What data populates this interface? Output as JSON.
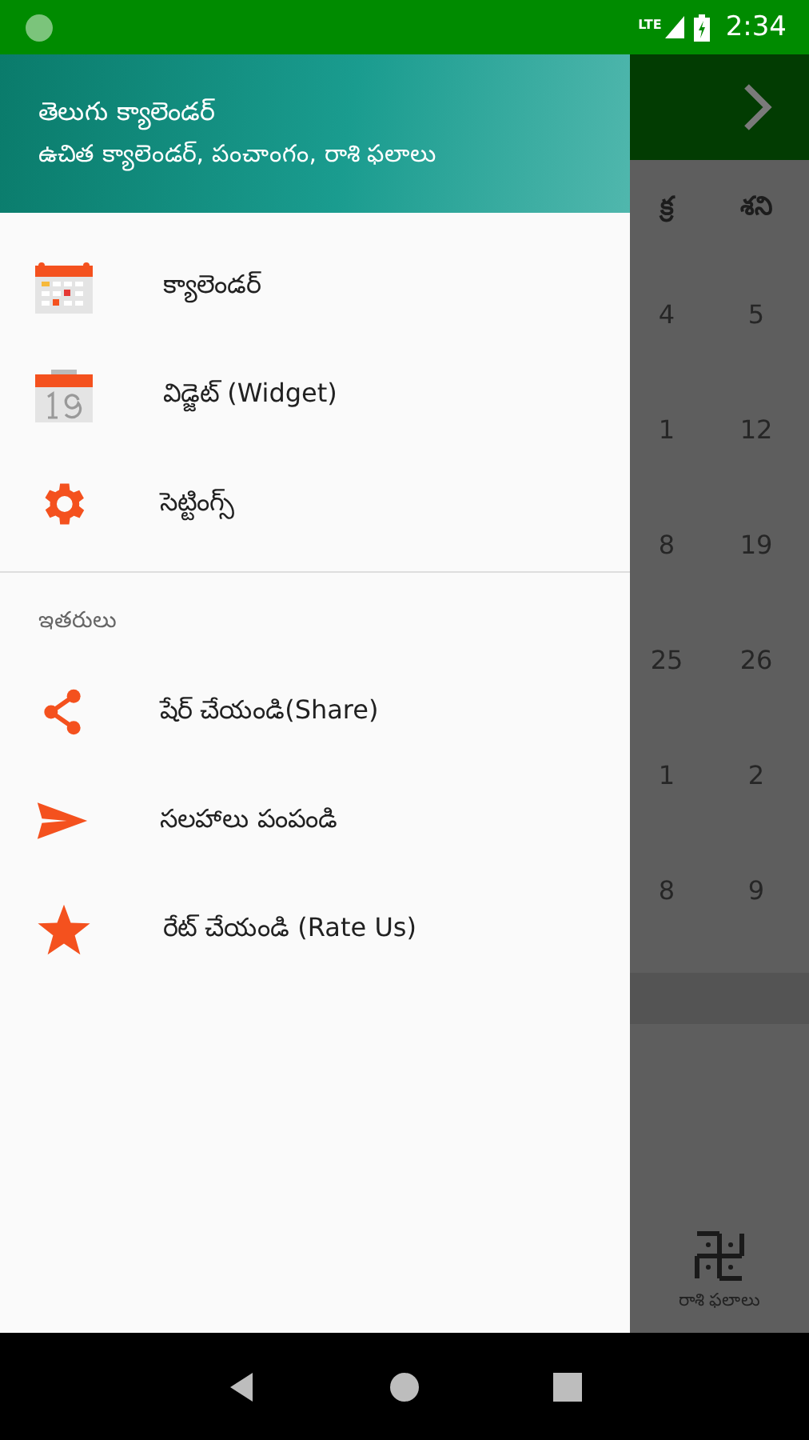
{
  "status_bar": {
    "time": "2:34",
    "network": "LTE"
  },
  "drawer": {
    "title": "తెలుగు క్యాలెండర్",
    "subtitle": "ఉచిత క్యాలెండర్, పంచాంగం, రాశి ఫలాలు",
    "items": [
      {
        "label": "క్యాలెండర్",
        "kind": "calendar"
      },
      {
        "label": "విడ్జెట్ (Widget)",
        "kind": "widget"
      },
      {
        "label": "సెట్టింగ్స్",
        "kind": "settings"
      }
    ],
    "section_title": "ఇతరులు",
    "other_items": [
      {
        "label": "షేర్ చేయండి(Share)",
        "kind": "share"
      },
      {
        "label": "సలహాలు పంపండి",
        "kind": "send"
      },
      {
        "label": "రేట్ చేయండి (Rate Us)",
        "kind": "rate"
      }
    ]
  },
  "background": {
    "weekdays": [
      "క్ర",
      "శని"
    ],
    "rows": [
      [
        "4",
        "5"
      ],
      [
        "1",
        "12"
      ],
      [
        "8",
        "19"
      ],
      [
        "25",
        "26"
      ],
      [
        "1",
        "2"
      ],
      [
        "8",
        "9"
      ]
    ],
    "bottom_tab": {
      "label": "రాశి ఫలాలు"
    }
  }
}
